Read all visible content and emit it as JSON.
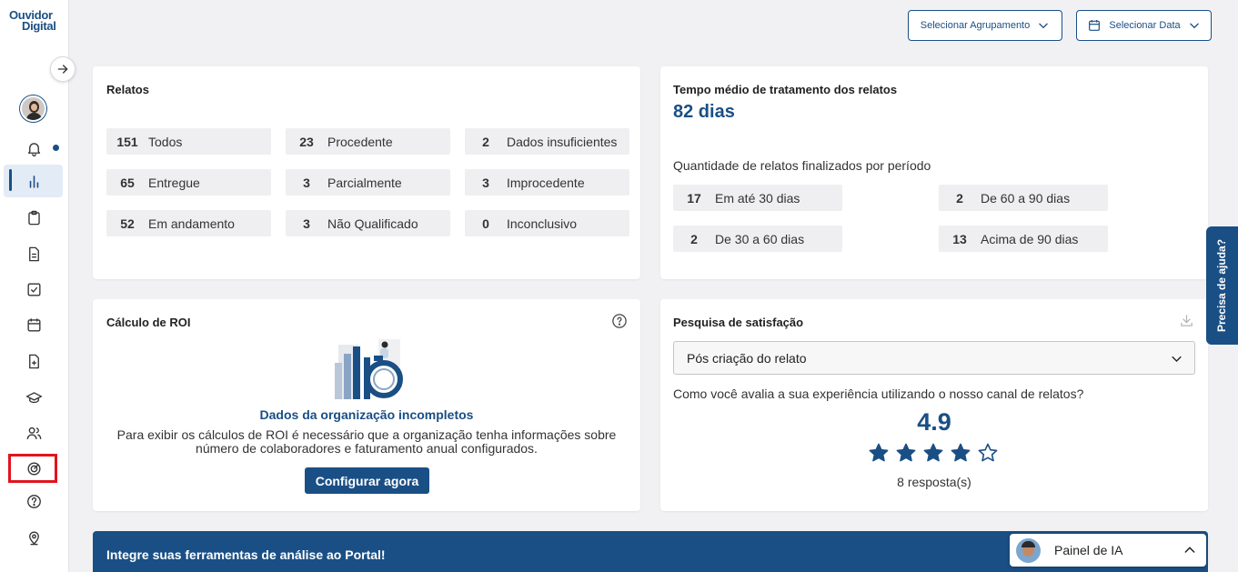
{
  "brand": {
    "logo_line1": "Ouvidor",
    "logo_line2": "Digital"
  },
  "top": {
    "grouping_label": "Selecionar Agrupamento",
    "date_label": "Selecionar Data"
  },
  "relatos": {
    "title": "Relatos",
    "items": [
      {
        "count": "151",
        "label": "Todos"
      },
      {
        "count": "23",
        "label": "Procedente"
      },
      {
        "count": "2",
        "label": "Dados insuficientes"
      },
      {
        "count": "65",
        "label": "Entregue"
      },
      {
        "count": "3",
        "label": "Parcialmente"
      },
      {
        "count": "3",
        "label": "Improcedente"
      },
      {
        "count": "52",
        "label": "Em andamento"
      },
      {
        "count": "3",
        "label": "Não Qualificado"
      },
      {
        "count": "0",
        "label": "Inconclusivo"
      }
    ]
  },
  "tempo": {
    "title": "Tempo médio de tratamento dos relatos",
    "value": "82 dias",
    "subtitle": "Quantidade de relatos finalizados por período",
    "items": [
      {
        "count": "17",
        "label": "Em até 30 dias"
      },
      {
        "count": "2",
        "label": "De 60 a 90 dias"
      },
      {
        "count": "2",
        "label": "De 30 a 60 dias"
      },
      {
        "count": "13",
        "label": "Acima de 90 dias"
      }
    ]
  },
  "roi": {
    "title": "Cálculo de ROI",
    "heading": "Dados da organização incompletos",
    "text_line1": "Para exibir os cálculos de ROI é necessário que a organização tenha informações sobre",
    "text_line2": "número de colaboradores e faturamento anual configurados.",
    "button": "Configurar agora"
  },
  "satisfacao": {
    "title": "Pesquisa de satisfação",
    "select_value": "Pós criação do relato",
    "question": "Como você avalia a sua experiência utilizando o nosso canal de relatos?",
    "score": "4.9",
    "rating": 4.9,
    "responses": "8 resposta(s)"
  },
  "help": {
    "label": "Precisa de ajuda?"
  },
  "banner": {
    "title": "Integre suas ferramentas de análise ao Portal!"
  },
  "ia_panel": {
    "label": "Painel de IA"
  },
  "colors": {
    "primary": "#1a4f85",
    "highlight": "#e0141e",
    "chip_bg": "#efeff1"
  }
}
